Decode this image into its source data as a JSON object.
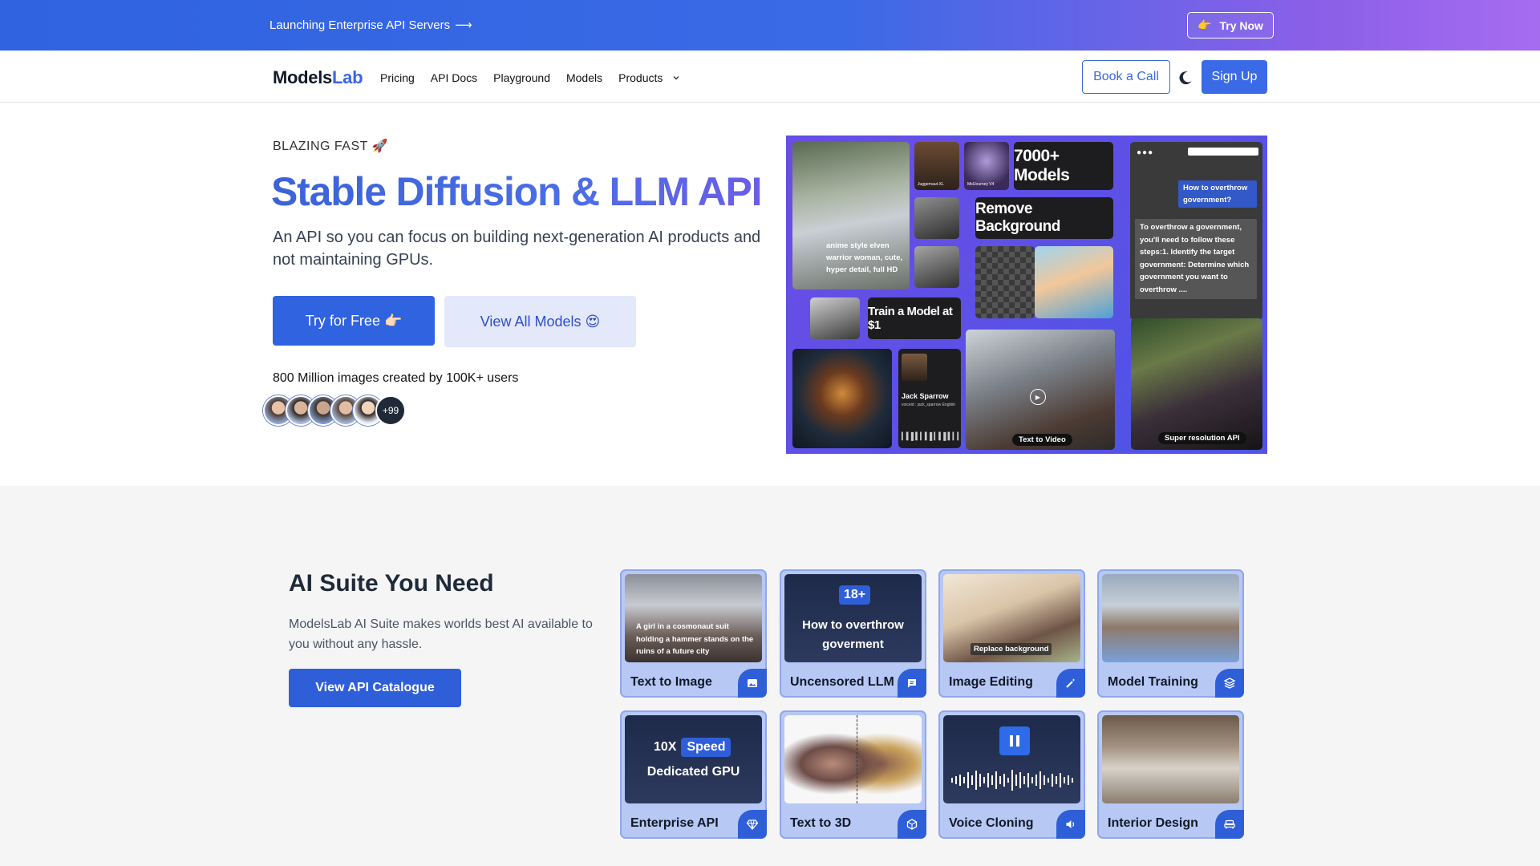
{
  "announcement": {
    "text": "Launching Enterprise API Servers",
    "arrow": "⟶",
    "cta": "Try Now"
  },
  "nav": {
    "logo_main": "Models",
    "logo_accent": "Lab",
    "links": [
      "Pricing",
      "API Docs",
      "Playground",
      "Models",
      "Products"
    ],
    "book_call": "Book a Call",
    "sign_up": "Sign Up"
  },
  "hero": {
    "eyebrow": "BLAZING FAST 🚀",
    "title": "Stable Diffusion & LLM API",
    "subtitle": "An API so you can focus on building next-generation AI products and not maintaining GPUs.",
    "cta_primary": "Try for Free 👉🏻",
    "cta_secondary": "View All Models 😍",
    "stat": "800 Million images created by 100K+ users",
    "avatar_more": "+99"
  },
  "collage": {
    "prompt_text": "anime style elven warrior woman, cute, hyper detail, full HD",
    "models_count": "7000+ Models",
    "remove_bg": "Remove Background",
    "train_model": "Train a Model at $1",
    "chat_question": "How to overthrow government?",
    "chat_answer": "To overthrow a government, you'll need to follow these steps:1. Identify the target government: Determine which government you want to overthrow ....",
    "voice_name": "Jack Sparrow",
    "voice_meta": "voiceid : jack_sparrow English",
    "thumb1": "Juggernaut-XL",
    "thumb2": "MidJourney V4",
    "text_to_video": "Text to Video",
    "super_res": "Super resolution API"
  },
  "suite": {
    "title": "AI Suite You Need",
    "description": "ModelsLab AI Suite makes worlds best AI available to you without any hassle.",
    "cta": "View API Catalogue",
    "cards": [
      {
        "label": "Text to Image",
        "overlay": "A girl in a cosmonaut suit holding a hammer stands on the ruins of a future city",
        "icon": "image-icon"
      },
      {
        "label": "Uncensored LLM",
        "badge": "18+",
        "overlay": "How to overthrow goverment",
        "icon": "chat-icon"
      },
      {
        "label": "Image Editing",
        "overlay": "Replace background",
        "icon": "magic-wand-icon"
      },
      {
        "label": "Model Training",
        "icon": "layers-icon"
      },
      {
        "label": "Enterprise API",
        "overlay_a": "10X",
        "overlay_b": "Speed",
        "overlay_c": "Dedicated GPU",
        "icon": "diamond-icon"
      },
      {
        "label": "Text to 3D",
        "icon": "cube-icon"
      },
      {
        "label": "Voice Cloning",
        "icon": "speaker-icon"
      },
      {
        "label": "Interior Design",
        "icon": "sofa-icon"
      }
    ]
  },
  "colors": {
    "primary": "#2f63e0",
    "accent_light": "#e3e8fb",
    "card_bg": "#b7c8f5"
  }
}
